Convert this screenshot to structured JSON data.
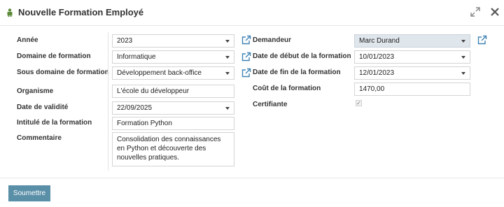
{
  "dialog": {
    "title": "Nouvelle Formation Employé"
  },
  "form": {
    "annee": {
      "label": "Année",
      "value": "2023"
    },
    "domaine": {
      "label": "Domaine de formation",
      "value": "Informatique"
    },
    "sous_domaine": {
      "label": "Sous domaine de formation",
      "value": "Développement back-office"
    },
    "organisme": {
      "label": "Organisme",
      "value": "L'école du développeur"
    },
    "date_validite": {
      "label": "Date de validité",
      "value": "22/09/2025"
    },
    "intitule": {
      "label": "Intitulé de la formation",
      "value": "Formation Python"
    },
    "commentaire": {
      "label": "Commentaire",
      "value": "Consolidation des connaissances en Python et découverte des nouvelles pratiques."
    },
    "demandeur": {
      "label": "Demandeur",
      "value": "Marc Durand"
    },
    "date_debut": {
      "label": "Date de début de la formation",
      "value": "10/01/2023"
    },
    "date_fin": {
      "label": "Date de fin de la formation",
      "value": "12/01/2023"
    },
    "cout": {
      "label": "Coût de la formation",
      "value": "1470,00"
    },
    "certifiante": {
      "label": "Certifiante",
      "checked": true
    }
  },
  "footer": {
    "submit_label": "Soumettre"
  },
  "colors": {
    "accent": "#5a8fa8",
    "selected_field": "#dfe6ec",
    "link_icon": "#3f83b5"
  },
  "icons": {
    "title": "person-icon",
    "expand": "expand-icon",
    "close": "close-icon",
    "link": "external-link-icon"
  }
}
